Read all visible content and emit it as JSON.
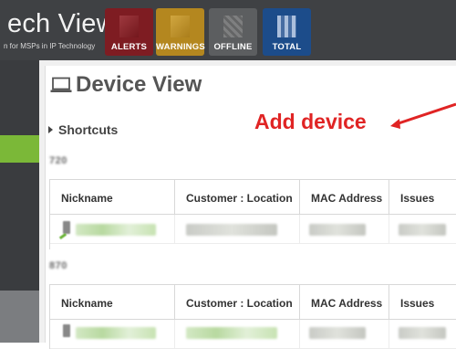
{
  "header": {
    "title": "ech View",
    "subtitle": "n for MSPs in IP Technology",
    "tiles": [
      {
        "label": "ALERTS",
        "color": "#7e1c22"
      },
      {
        "label": "WARNINGS",
        "color": "#b4871f"
      },
      {
        "label": "OFFLINE",
        "color": "#5c5e60"
      },
      {
        "label": "TOTAL",
        "color": "#1c4c8a"
      }
    ]
  },
  "sidebar": {
    "active_color": "#7bb838"
  },
  "page": {
    "title": "Device View",
    "title_icon": "laptop-icon",
    "shortcuts_label": "Shortcuts"
  },
  "annotation": {
    "text": "Add device",
    "color": "#e02424"
  },
  "groups": [
    {
      "id": "720",
      "columns": [
        "Nickname",
        "Customer : Location",
        "MAC Address",
        "Issues"
      ]
    },
    {
      "id": "870",
      "columns": [
        "Nickname",
        "Customer : Location",
        "MAC Address",
        "Issues"
      ]
    }
  ]
}
